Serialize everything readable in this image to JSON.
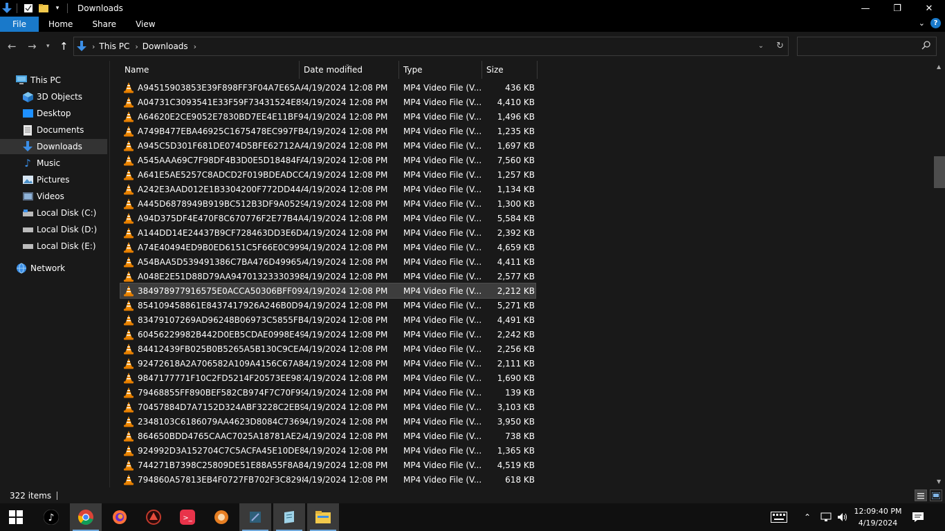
{
  "window": {
    "title": "Downloads",
    "minimize": "—",
    "maximize": "❐",
    "close": "✕"
  },
  "ribbon": {
    "tabs": [
      "File",
      "Home",
      "Share",
      "View"
    ],
    "help": "?"
  },
  "address": {
    "crumbs": [
      "This PC",
      "Downloads"
    ],
    "search_placeholder": ""
  },
  "nav": {
    "items": [
      {
        "label": "This PC",
        "icon": "computer-icon"
      },
      {
        "label": "3D Objects",
        "icon": "cube-icon"
      },
      {
        "label": "Desktop",
        "icon": "desktop-icon"
      },
      {
        "label": "Documents",
        "icon": "document-icon"
      },
      {
        "label": "Downloads",
        "icon": "download-icon",
        "selected": true
      },
      {
        "label": "Music",
        "icon": "music-icon"
      },
      {
        "label": "Pictures",
        "icon": "pictures-icon"
      },
      {
        "label": "Videos",
        "icon": "videos-icon"
      },
      {
        "label": "Local Disk (C:)",
        "icon": "drive-icon"
      },
      {
        "label": "Local Disk (D:)",
        "icon": "drive-icon"
      },
      {
        "label": "Local Disk (E:)",
        "icon": "drive-icon"
      },
      {
        "label": "Network",
        "icon": "network-icon"
      }
    ]
  },
  "columns": {
    "name": "Name",
    "date": "Date modified",
    "type": "Type",
    "size": "Size"
  },
  "files": [
    {
      "name": "A94515903853E39F898FF3F04A7E65AA_vi...",
      "date": "4/19/2024 12:08 PM",
      "type": "MP4 Video File (V...",
      "size": "436 KB"
    },
    {
      "name": "A04731C3093541E33F59F73431524E89_vid...",
      "date": "4/19/2024 12:08 PM",
      "type": "MP4 Video File (V...",
      "size": "4,410 KB"
    },
    {
      "name": "A64620E2CE9052E7830BD7EE4E11BF93_vi...",
      "date": "4/19/2024 12:08 PM",
      "type": "MP4 Video File (V...",
      "size": "1,496 KB"
    },
    {
      "name": "A749B477EBA46925C1675478EC997FB6_vi...",
      "date": "4/19/2024 12:08 PM",
      "type": "MP4 Video File (V...",
      "size": "1,235 KB"
    },
    {
      "name": "A945C5D301F681DE074D5BFE62712AAC_...",
      "date": "4/19/2024 12:08 PM",
      "type": "MP4 Video File (V...",
      "size": "1,697 KB"
    },
    {
      "name": "A545AAA69C7F98DF4B3D0E5D18484FA9_...",
      "date": "4/19/2024 12:08 PM",
      "type": "MP4 Video File (V...",
      "size": "7,560 KB"
    },
    {
      "name": "A641E5AE5257C8ADCD2F019BDEADCCA...",
      "date": "4/19/2024 12:08 PM",
      "type": "MP4 Video File (V...",
      "size": "1,257 KB"
    },
    {
      "name": "A242E3AAD012E1B3304200F772DD44A8_...",
      "date": "4/19/2024 12:08 PM",
      "type": "MP4 Video File (V...",
      "size": "1,134 KB"
    },
    {
      "name": "A445D6878949B919BC512B3DF9A0529C_...",
      "date": "4/19/2024 12:08 PM",
      "type": "MP4 Video File (V...",
      "size": "1,300 KB"
    },
    {
      "name": "A94D375DF4E470F8C670776F2E77B4A3_vi...",
      "date": "4/19/2024 12:08 PM",
      "type": "MP4 Video File (V...",
      "size": "5,584 KB"
    },
    {
      "name": "A144DD14E24437B9CF728463DD3E6D8B_...",
      "date": "4/19/2024 12:08 PM",
      "type": "MP4 Video File (V...",
      "size": "2,392 KB"
    },
    {
      "name": "A74E40494ED9B0ED6151C5F66E0C999C_v...",
      "date": "4/19/2024 12:08 PM",
      "type": "MP4 Video File (V...",
      "size": "4,659 KB"
    },
    {
      "name": "A54BAA5D539491386C7BA476D49965AE_...",
      "date": "4/19/2024 12:08 PM",
      "type": "MP4 Video File (V...",
      "size": "4,411 KB"
    },
    {
      "name": "A048E2E51D88D79AA94701323330398C_v...",
      "date": "4/19/2024 12:08 PM",
      "type": "MP4 Video File (V...",
      "size": "2,577 KB"
    },
    {
      "name": "384978977916575E0ACCA50306BFF092_vi...",
      "date": "4/19/2024 12:08 PM",
      "type": "MP4 Video File (V...",
      "size": "2,212 KB",
      "selected": true
    },
    {
      "name": "854109458861E8437417926A246B0D9E_vi...",
      "date": "4/19/2024 12:08 PM",
      "type": "MP4 Video File (V...",
      "size": "5,271 KB"
    },
    {
      "name": "83479107269AD96248B06973C5855FBC_vi...",
      "date": "4/19/2024 12:08 PM",
      "type": "MP4 Video File (V...",
      "size": "4,491 KB"
    },
    {
      "name": "60456229982B442D0EB5CDAE0998E496_vi...",
      "date": "4/19/2024 12:08 PM",
      "type": "MP4 Video File (V...",
      "size": "2,242 KB"
    },
    {
      "name": "84412439FB025B0B5265A5B130C9CEAE_v...",
      "date": "4/19/2024 12:08 PM",
      "type": "MP4 Video File (V...",
      "size": "2,256 KB"
    },
    {
      "name": "92472618A2A706582A109A4156C67A84_v...",
      "date": "4/19/2024 12:08 PM",
      "type": "MP4 Video File (V...",
      "size": "2,111 KB"
    },
    {
      "name": "9847177771F10C2FD5214F20573EE987_vid...",
      "date": "4/19/2024 12:08 PM",
      "type": "MP4 Video File (V...",
      "size": "1,690 KB"
    },
    {
      "name": "79468855FF890BEF582CB974F7C70F99_vi...",
      "date": "4/19/2024 12:08 PM",
      "type": "MP4 Video File (V...",
      "size": "139 KB"
    },
    {
      "name": "70457884D7A7152D324ABF3228C2EB92_v...",
      "date": "4/19/2024 12:08 PM",
      "type": "MP4 Video File (V...",
      "size": "3,103 KB"
    },
    {
      "name": "2348103C6186079AA4623D8084C7369C_vi...",
      "date": "4/19/2024 12:08 PM",
      "type": "MP4 Video File (V...",
      "size": "3,950 KB"
    },
    {
      "name": "864650BDD4765CAAC7025A18781AE2A2_...",
      "date": "4/19/2024 12:08 PM",
      "type": "MP4 Video File (V...",
      "size": "738 KB"
    },
    {
      "name": "924992D3A152704C7C5ACFA45E10DE83_...",
      "date": "4/19/2024 12:08 PM",
      "type": "MP4 Video File (V...",
      "size": "1,365 KB"
    },
    {
      "name": "744271B7398C25809DE51E88A55F8A89_vi...",
      "date": "4/19/2024 12:08 PM",
      "type": "MP4 Video File (V...",
      "size": "4,519 KB"
    },
    {
      "name": "794860A57813EB4F0727FB702F3C8298_vi...",
      "date": "4/19/2024 12:08 PM",
      "type": "MP4 Video File (V...",
      "size": "618 KB"
    }
  ],
  "status": {
    "item_count": "322 items"
  },
  "taskbar": {
    "apps": [
      "start",
      "tiktok",
      "chrome",
      "firefox",
      "game-app",
      "vpn-app",
      "torrent-app",
      "tool-app",
      "notes-app",
      "file-explorer"
    ],
    "time": "12:09:40 PM",
    "date": "4/19/2024"
  },
  "colors": {
    "accent": "#1979ca",
    "background": "#191919",
    "selected_row": "#3d3d3d",
    "vlc_orange": "#f08a00"
  }
}
